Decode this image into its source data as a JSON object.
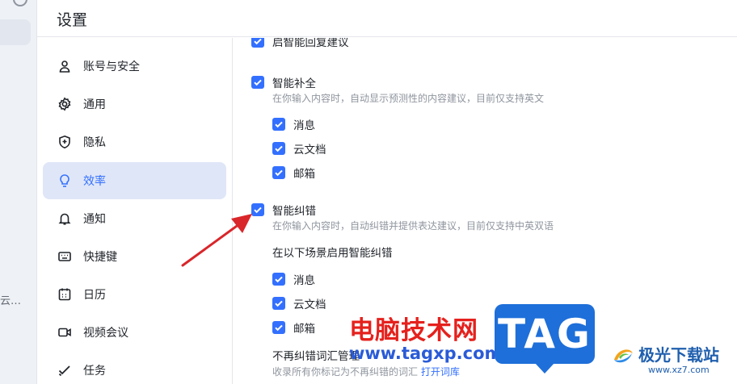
{
  "background": {
    "bottom_text": "云…"
  },
  "dialog": {
    "title": "设置"
  },
  "nav": {
    "items": [
      {
        "label": "账号与安全",
        "icon": "user-icon"
      },
      {
        "label": "通用",
        "icon": "gear-icon"
      },
      {
        "label": "隐私",
        "icon": "shield-icon"
      },
      {
        "label": "效率",
        "icon": "lightbulb-icon",
        "active": true
      },
      {
        "label": "通知",
        "icon": "bell-icon"
      },
      {
        "label": "快捷键",
        "icon": "keyboard-icon"
      },
      {
        "label": "日历",
        "icon": "calendar-icon"
      },
      {
        "label": "视频会议",
        "icon": "video-icon"
      },
      {
        "label": "任务",
        "icon": "task-check-icon"
      }
    ]
  },
  "content": {
    "top_cut_label": "启智能回复建议",
    "smart_complete": {
      "label": "智能补全",
      "checked": true,
      "desc": "在你输入内容时，自动显示预测性的内容建议，目前仅支持英文",
      "options": [
        {
          "label": "消息",
          "checked": true
        },
        {
          "label": "云文档",
          "checked": true
        },
        {
          "label": "邮箱",
          "checked": true
        }
      ]
    },
    "smart_correct": {
      "label": "智能纠错",
      "checked": true,
      "desc": "在你输入内容时，自动纠错并提供表达建议，目前仅支持中英双语",
      "scene_label": "在以下场景启用智能纠错",
      "options": [
        {
          "label": "消息",
          "checked": true
        },
        {
          "label": "云文档",
          "checked": true
        },
        {
          "label": "邮箱",
          "checked": true
        }
      ],
      "vocab_title": "不再纠错词汇管理",
      "vocab_desc": "收录所有你标记为不再纠错的词汇",
      "vocab_link": "打开词库"
    }
  },
  "watermark": {
    "text": "电脑技术网",
    "url": "www.tagxp.com",
    "tag": "TAG",
    "brand_name": "极光下载站",
    "brand_url": "www.xz7.com"
  },
  "colors": {
    "accent": "#3370ff",
    "active_nav_bg": "#dfe6f7",
    "arrow": "#d9262a"
  }
}
